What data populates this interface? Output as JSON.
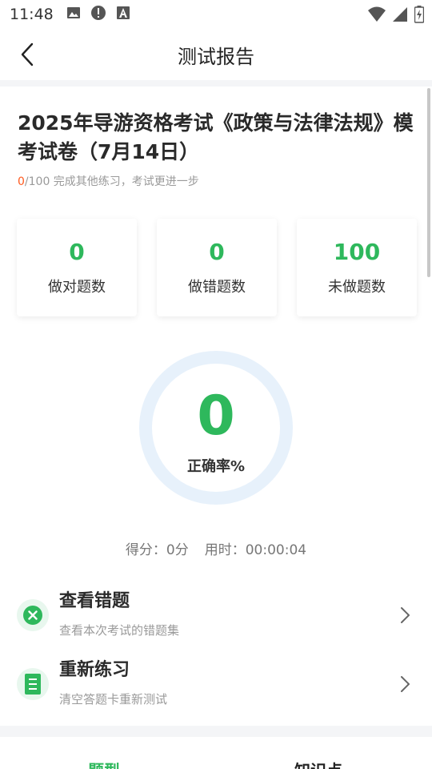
{
  "status_bar": {
    "time": "11:48",
    "left_icons": [
      "image-icon",
      "alert-icon",
      "text-a-icon"
    ],
    "right_icons": [
      "wifi-icon",
      "signal-icon",
      "battery-icon"
    ]
  },
  "header": {
    "title": "测试报告",
    "back_icon": "chevron-left-icon"
  },
  "exam": {
    "title": "2025年导游资格考试《政策与法律法规》模考试卷（7月14日）",
    "progress_done": "0",
    "progress_rest": "/100 完成其他练习，考试更进一步"
  },
  "stats": [
    {
      "value": "0",
      "label": "做对题数"
    },
    {
      "value": "0",
      "label": "做错题数"
    },
    {
      "value": "100",
      "label": "未做题数"
    }
  ],
  "accuracy": {
    "value": "0",
    "label": "正确率%",
    "fraction": 0
  },
  "score_line": {
    "score": "得分：0分",
    "time": "用时：00:00:04"
  },
  "actions": [
    {
      "title": "查看错题",
      "subtitle": "查看本次考试的错题集",
      "icon": "close-circle-icon"
    },
    {
      "title": "重新练习",
      "subtitle": "清空答题卡重新测试",
      "icon": "document-icon"
    }
  ],
  "bottom_tabs": [
    {
      "label": "题型",
      "active": true
    },
    {
      "label": "知识点",
      "active": false
    }
  ],
  "colors": {
    "accent": "#2eb85c",
    "progress_done": "#ff5a1f",
    "ring_track": "#e7f1fb",
    "muted_text": "#9a9a9a"
  }
}
